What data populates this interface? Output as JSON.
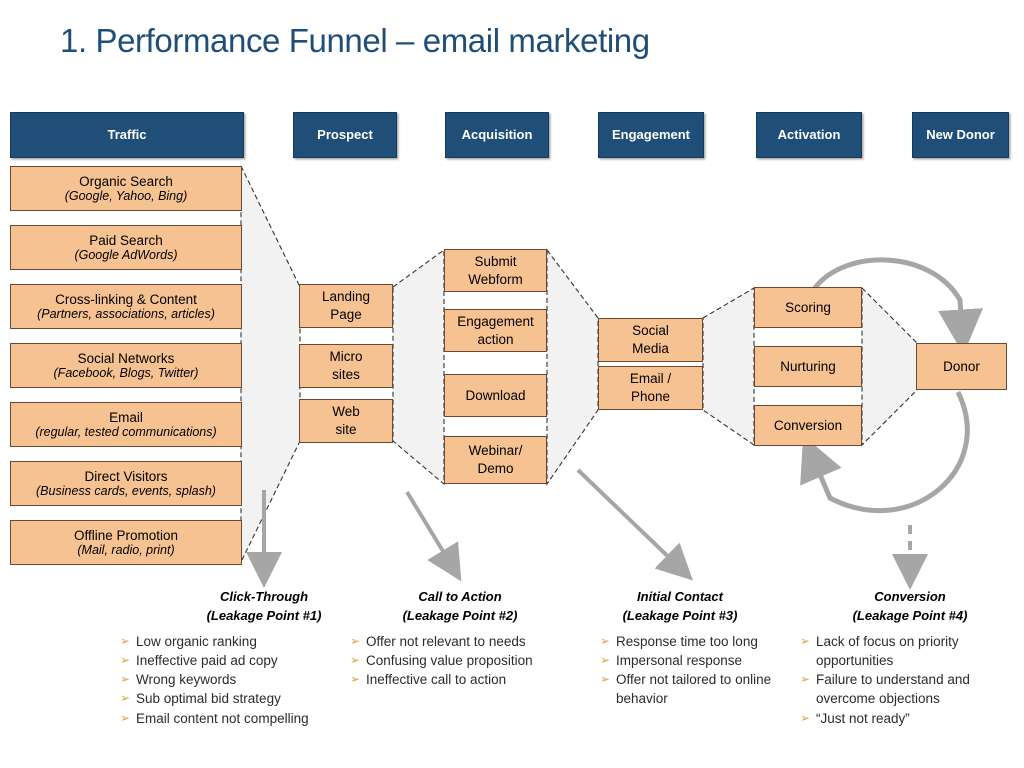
{
  "title": "1. Performance Funnel – email marketing",
  "colors": {
    "header_blue": "#1F4E79",
    "box_orange": "#F7C292",
    "bullet_gold": "#D9A441",
    "arrow_gray": "#A6A6A6",
    "funnel_gray": "#F2F2F2"
  },
  "stages": [
    {
      "id": "traffic",
      "label": "Traffic"
    },
    {
      "id": "prospect",
      "label": "Prospect"
    },
    {
      "id": "acquisition",
      "label": "Acquisition"
    },
    {
      "id": "engagement",
      "label": "Engagement"
    },
    {
      "id": "activation",
      "label": "Activation"
    },
    {
      "id": "new-donor",
      "label": "New Donor"
    }
  ],
  "traffic_items": [
    {
      "main": "Organic Search",
      "sub": "(Google, Yahoo, Bing)"
    },
    {
      "main": "Paid Search",
      "sub": "(Google AdWords)"
    },
    {
      "main": "Cross-linking & Content",
      "sub": "(Partners, associations, articles)"
    },
    {
      "main": "Social Networks",
      "sub": "(Facebook, Blogs, Twitter)"
    },
    {
      "main": "Email",
      "sub": "(regular, tested communications)"
    },
    {
      "main": "Direct Visitors",
      "sub": "(Business cards, events, splash)"
    },
    {
      "main": "Offline Promotion",
      "sub": "(Mail, radio, print)"
    }
  ],
  "prospect_items": [
    {
      "l1": "Landing",
      "l2": "Page"
    },
    {
      "l1": "Micro",
      "l2": "sites"
    },
    {
      "l1": "Web",
      "l2": "site"
    }
  ],
  "acquisition_items": [
    {
      "l1": "Submit",
      "l2": "Webform"
    },
    {
      "l1": "Engagement",
      "l2": "action"
    },
    {
      "l1": "Download",
      "l2": ""
    },
    {
      "l1": "Webinar/",
      "l2": "Demo"
    }
  ],
  "engagement_items": [
    {
      "l1": "Social",
      "l2": "Media"
    },
    {
      "l1": "Email /",
      "l2": "Phone"
    }
  ],
  "activation_items": [
    {
      "l1": "Scoring",
      "l2": ""
    },
    {
      "l1": "Nurturing",
      "l2": ""
    },
    {
      "l1": "Conversion",
      "l2": ""
    }
  ],
  "donor_item": {
    "l1": "Donor",
    "l2": ""
  },
  "leakage_points": [
    {
      "title": "Click-Through",
      "subtitle": "(Leakage Point #1)",
      "bullets": [
        "Low organic ranking",
        "Ineffective paid ad copy",
        "Wrong keywords",
        "Sub optimal bid strategy",
        "Email content not compelling"
      ]
    },
    {
      "title": "Call to Action",
      "subtitle": "(Leakage Point #2)",
      "bullets": [
        "Offer not relevant to needs",
        "Confusing value proposition",
        "Ineffective call to action"
      ]
    },
    {
      "title": "Initial Contact",
      "subtitle": "(Leakage Point #3)",
      "bullets": [
        "Response time too long",
        "Impersonal response",
        "Offer not tailored to online behavior"
      ]
    },
    {
      "title": "Conversion",
      "subtitle": "(Leakage Point #4)",
      "bullets": [
        "Lack of focus on priority opportunities",
        "Failure to understand and overcome objections",
        "“Just not ready”"
      ]
    }
  ],
  "bullet_glyph": "➢"
}
